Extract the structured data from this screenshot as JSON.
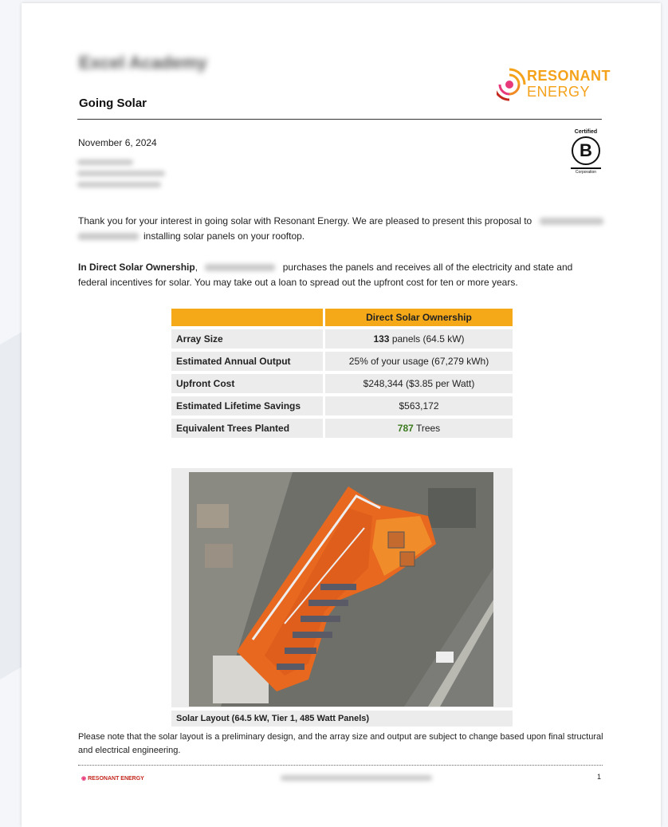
{
  "header": {
    "organization": "Excel Academy",
    "subtitle": "Going Solar"
  },
  "logo": {
    "line1": "RESONANT",
    "line2": "ENERGY",
    "color": "#f5a21b"
  },
  "bcorp": {
    "certified": "Certified",
    "letter": "B",
    "corporation": "Corporation"
  },
  "letter": {
    "date": "November 6, 2024",
    "intro_a": "Thank you for your interest in going solar with Resonant Energy. We are pleased to present this proposal to",
    "intro_b": "installing solar panels on your rooftop.",
    "ownership_bold": "In Direct Solar Ownership",
    "ownership_a": ",",
    "ownership_b": "purchases the panels and receives all of the electricity and state and federal incentives for solar. You may take out a loan to spread out the upfront cost for ten or more years."
  },
  "table": {
    "header": "Direct Solar Ownership",
    "rows": [
      {
        "label": "Array Size",
        "value_strong": "133",
        "value_rest": " panels (64.5 kW)"
      },
      {
        "label": "Estimated Annual Output",
        "value_strong": "",
        "value_rest": "25% of your usage (67,279 kWh)"
      },
      {
        "label": "Upfront Cost",
        "value_strong": "",
        "value_rest": "$248,344 ($3.85 per Watt)"
      },
      {
        "label": "Estimated Lifetime Savings",
        "value_strong": "",
        "value_rest": "$563,172"
      },
      {
        "label": "Equivalent Trees Planted",
        "value_strong": "787",
        "value_rest": " Trees"
      }
    ]
  },
  "layout": {
    "caption": "Solar Layout (64.5 kW, Tier 1, 485 Watt Panels)"
  },
  "note": "Please note that the solar layout is a preliminary design, and the array size and output are subject to change based upon final structural and electrical engineering.",
  "footer": {
    "logo_text": "RESONANT ENERGY",
    "page_number": "1"
  }
}
